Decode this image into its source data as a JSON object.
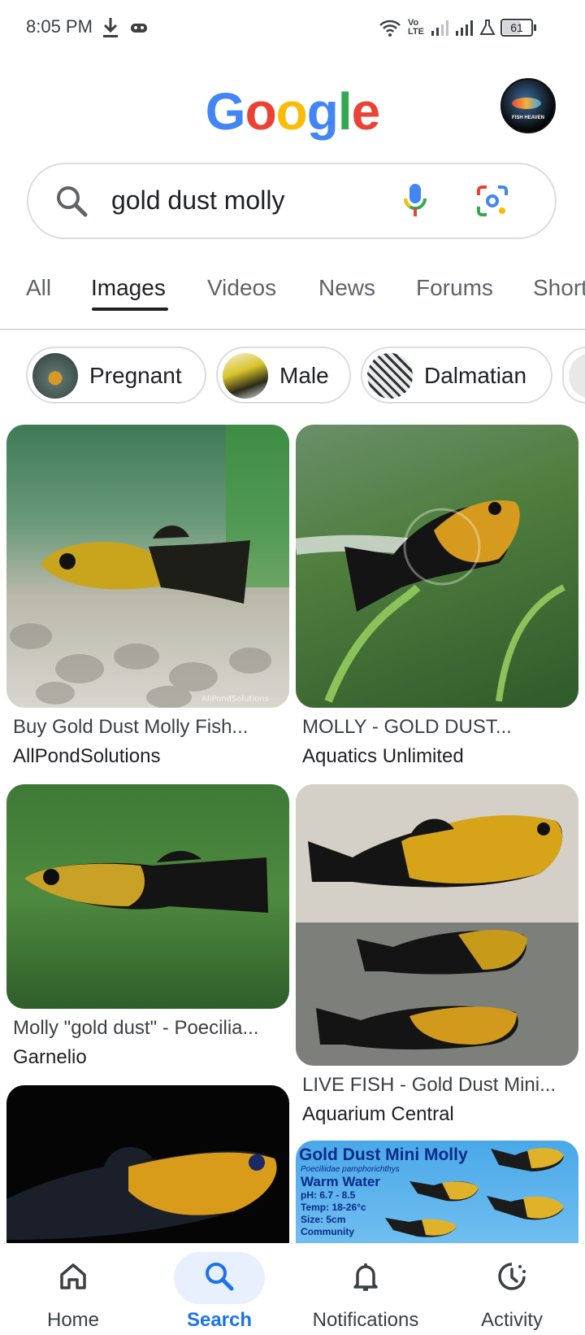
{
  "status_bar": {
    "time": "8:05 PM",
    "battery": "61",
    "network_label": "Vo LTE"
  },
  "header": {
    "logo_letters": [
      "G",
      "o",
      "o",
      "g",
      "l",
      "e"
    ],
    "logo_colors": [
      "#4285f4",
      "#ea4335",
      "#fbbc05",
      "#4285f4",
      "#34a853",
      "#ea4335"
    ],
    "avatar_text": "FISH HEAVEN"
  },
  "search": {
    "query": "gold dust molly"
  },
  "tabs": [
    {
      "label": "All"
    },
    {
      "label": "Images"
    },
    {
      "label": "Videos"
    },
    {
      "label": "News"
    },
    {
      "label": "Forums"
    },
    {
      "label": "Short"
    }
  ],
  "chips": [
    {
      "label": "Pregnant"
    },
    {
      "label": "Male"
    },
    {
      "label": "Dalmatian"
    }
  ],
  "results": [
    {
      "title": "Buy Gold Dust Molly Fish...",
      "source": "AllPondSolutions",
      "watermark": "AllPondSolutions"
    },
    {
      "title": "MOLLY - GOLD DUST...",
      "source": "Aquatics Unlimited"
    },
    {
      "title": "Molly \"gold dust\" - Poecilia...",
      "source": "Garnelio"
    },
    {
      "title": "LIVE FISH - Gold Dust Mini...",
      "source": "Aquarium Central"
    },
    {
      "title": "",
      "source": ""
    },
    {
      "title": "",
      "source": "",
      "poster": {
        "heading": "Gold Dust Mini Molly",
        "latin": "Poeciliidae pamphorichthys",
        "line1": "Warm Water",
        "line2": "pH: 6.7 - 8.5",
        "line3": "Temp: 18-26°c",
        "line4": "Size: 5cm",
        "line5": "Community"
      }
    }
  ],
  "bottom_nav": [
    {
      "label": "Home",
      "icon": "home-icon"
    },
    {
      "label": "Search",
      "icon": "search-icon"
    },
    {
      "label": "Notifications",
      "icon": "bell-icon"
    },
    {
      "label": "Activity",
      "icon": "activity-icon"
    }
  ],
  "colors": {
    "accent": "#1a73e8",
    "nav_active_bg": "#e8f0fe"
  }
}
